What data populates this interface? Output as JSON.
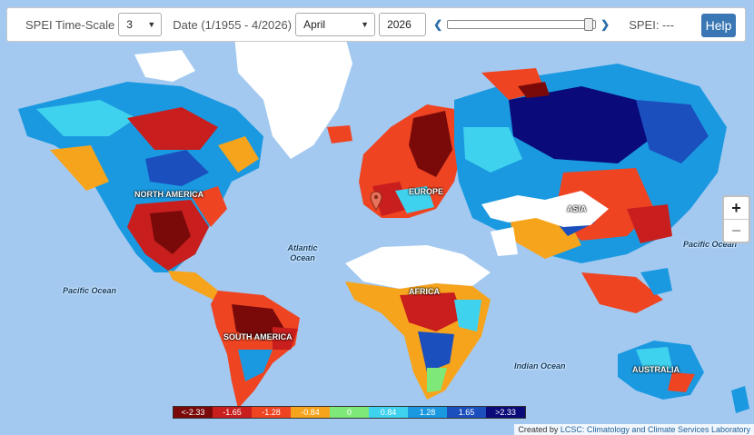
{
  "toolbar": {
    "timescale_label": "SPEI Time-Scale",
    "timescale_value": "3",
    "date_label": "Date (1/1955 - 4/2026)",
    "month_value": "April",
    "year_value": "2026",
    "prev_arrow": "❮",
    "next_arrow": "❯",
    "spei_label": "SPEI: ---",
    "help_label": "Help",
    "slider_position": 1.0
  },
  "zoom": {
    "in_label": "+",
    "out_label": "−"
  },
  "legend": {
    "entries": [
      {
        "label": "<-2.33",
        "color": "#7a0a0a"
      },
      {
        "label": "-1.65",
        "color": "#c81e1e"
      },
      {
        "label": "-1.28",
        "color": "#ee4422"
      },
      {
        "label": "-0.84",
        "color": "#f7a41d"
      },
      {
        "label": "0",
        "color": "#7ee878"
      },
      {
        "label": "0.84",
        "color": "#3fd2ee"
      },
      {
        "label": "1.28",
        "color": "#1a99e0"
      },
      {
        "label": "1.65",
        "color": "#1b4fbe"
      },
      {
        "label": ">2.33",
        "color": "#0a0a7a"
      }
    ]
  },
  "attribution": {
    "prefix": "Created by",
    "org": "LCSC: Climatology and Climate Services Laboratory"
  },
  "map_labels": {
    "north_america": "NORTH AMERICA",
    "south_america": "SOUTH AMERICA",
    "europe": "EUROPE",
    "africa": "AFRICA",
    "asia": "ASIA",
    "australia": "AUSTRALIA"
  },
  "ocean_labels": {
    "atlantic": "Atlantic Ocean",
    "pacific_west": "Pacific Ocean",
    "pacific_east": "Pacific Ocean",
    "indian": "Indian Ocean"
  }
}
